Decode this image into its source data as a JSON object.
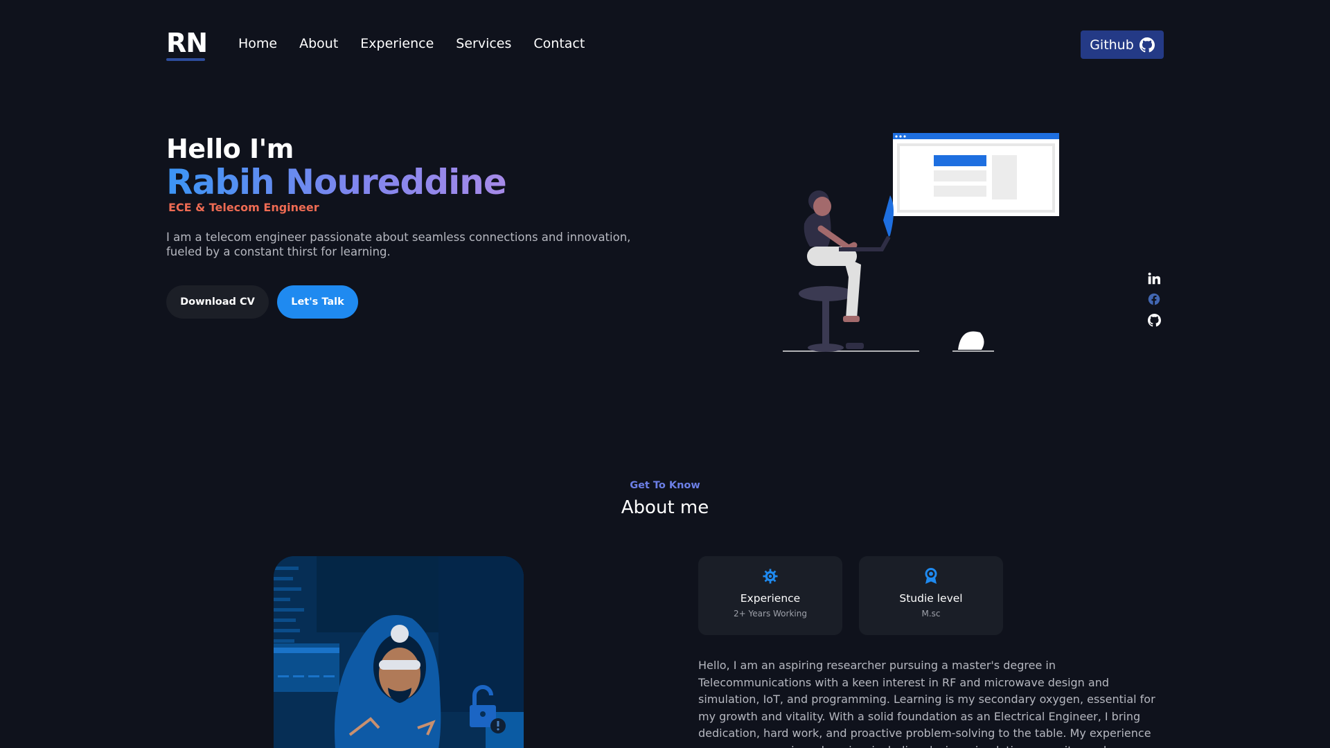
{
  "nav": {
    "logo": "RN",
    "links": [
      "Home",
      "About",
      "Experience",
      "Services",
      "Contact"
    ],
    "github_label": "Github"
  },
  "hero": {
    "greeting": "Hello I'm",
    "name": "Rabih Noureddine",
    "role": "ECE & Telecom Engineer",
    "description": "I am a telecom engineer passionate about seamless connections and innovation, fueled by a constant thirst for learning.",
    "download_cv": "Download CV",
    "lets_talk": "Let's Talk"
  },
  "socials": [
    "linkedin-icon",
    "facebook-icon",
    "github-icon"
  ],
  "about": {
    "kicker": "Get To Know",
    "title": "About me",
    "cards": [
      {
        "icon": "gear-icon",
        "title": "Experience",
        "subtitle": "2+ Years Working"
      },
      {
        "icon": "award-icon",
        "title": "Studie level",
        "subtitle": "M.sc"
      }
    ],
    "text": "Hello, I am an aspiring researcher pursuing a master's degree in Telecommunications with a keen interest in RF and microwave design and simulation, IoT, and programming. Learning is my secondary oxygen, essential for my growth and vitality. With a solid foundation as an Electrical Engineer, I bring dedication, hard work, and proactive problem-solving to the table. My experience spans across various domains, including design, simulation, security, and"
  },
  "colors": {
    "background": "#0f121c",
    "accent_blue": "#1f8af0",
    "role_orange": "#ee6b53",
    "github_button": "#243a86",
    "card_bg": "#1a1e27"
  }
}
